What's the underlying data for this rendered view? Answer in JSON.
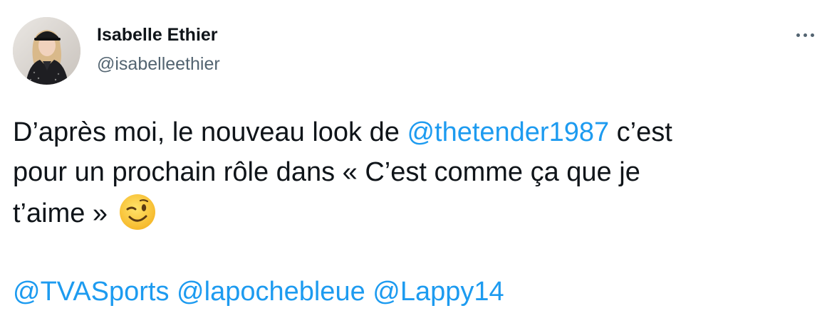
{
  "author": {
    "display_name": "Isabelle Ethier",
    "handle": "@isabelleethier"
  },
  "more_menu": {
    "icon": "more-horizontal-icon"
  },
  "tweet": {
    "line1": {
      "text_before": "D’après moi, le nouveau look de ",
      "mention": "@thetender1987",
      "text_after": " c’est"
    },
    "line2": "pour un prochain rôle dans « C’est comme ça que je",
    "line3": "t’aime »",
    "emoji": "winking-face-emoji",
    "mentions": [
      "@TVASports",
      "@lapochebleue",
      "@Lappy14"
    ]
  },
  "colors": {
    "mention": "#1d9bf0",
    "text": "#0f1419",
    "secondary": "#536471"
  }
}
